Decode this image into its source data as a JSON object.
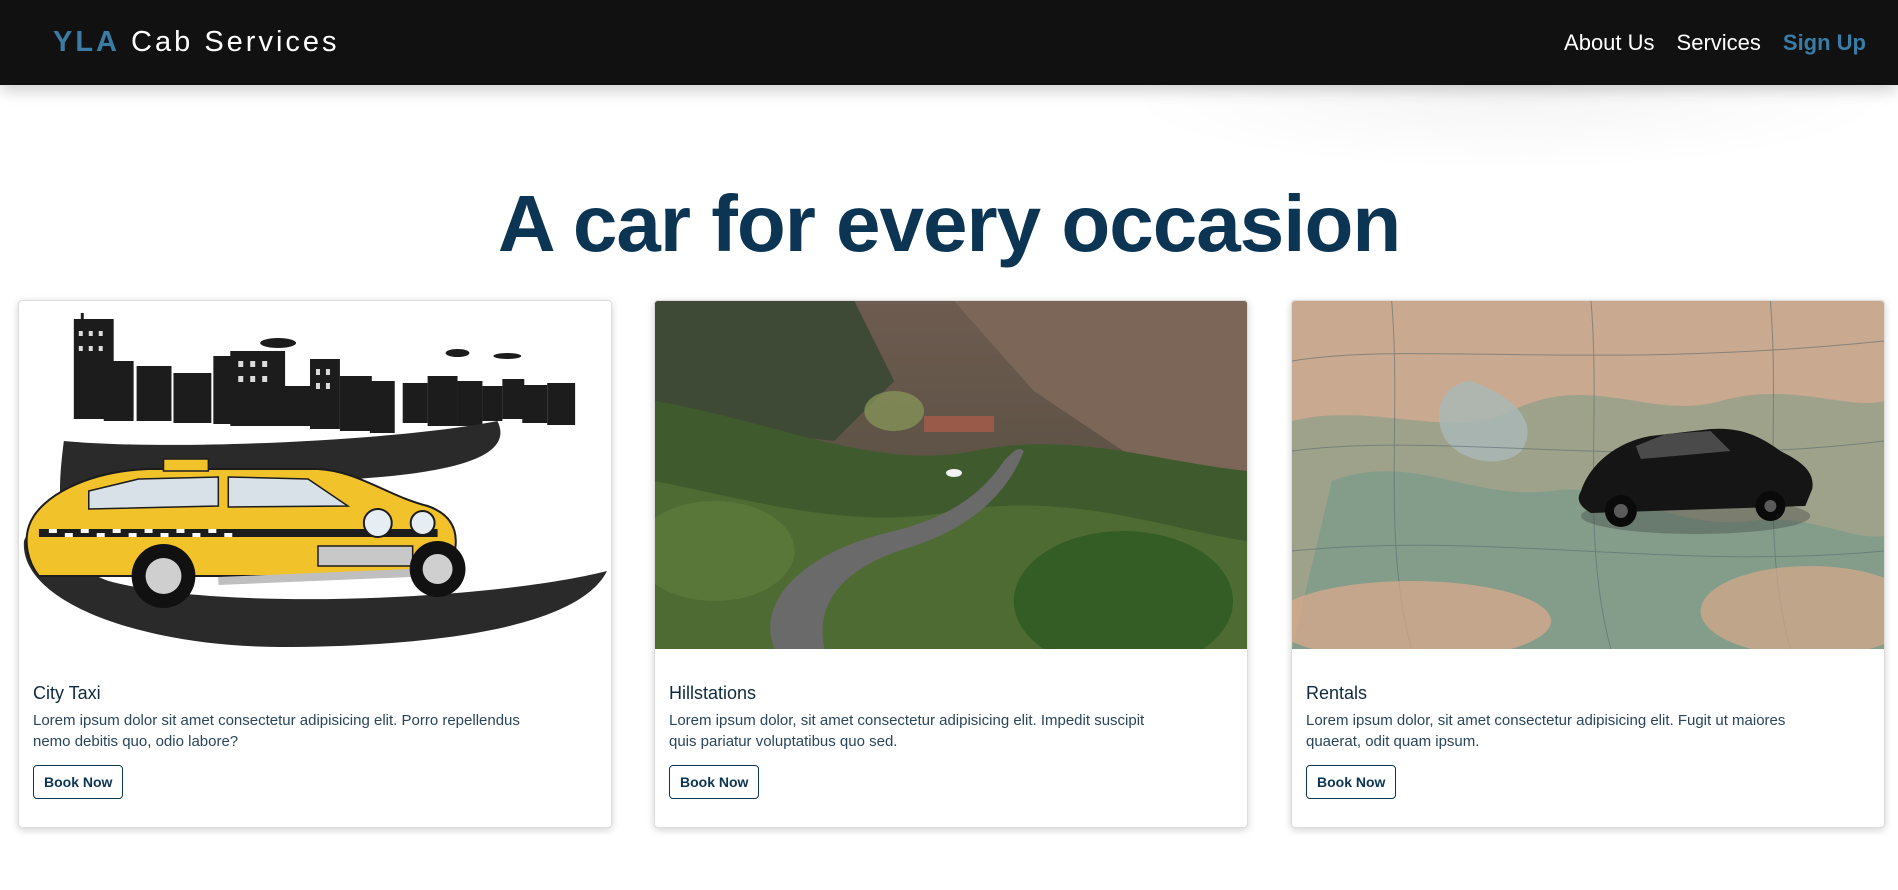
{
  "nav": {
    "brand_accent": "YLA",
    "brand_rest": " Cab Services",
    "links": [
      "About Us",
      "Services",
      "Sign Up"
    ]
  },
  "hero": {
    "headline": "A car for every occasion"
  },
  "cards": [
    {
      "title": "City Taxi",
      "text": "Lorem ipsum dolor sit amet consectetur adipisicing elit. Porro repellendus nemo debitis quo, odio labore?",
      "button": "Book Now"
    },
    {
      "title": "Hillstations",
      "text": "Lorem ipsum dolor, sit amet consectetur adipisicing elit. Impedit suscipit quis pariatur voluptatibus quo sed.",
      "button": "Book Now"
    },
    {
      "title": "Rentals",
      "text": "Lorem ipsum dolor, sit amet consectetur adipisicing elit. Fugit ut maiores quaerat, odit quam ipsum.",
      "button": "Book Now"
    }
  ],
  "colors": {
    "nav_bg": "#111111",
    "accent": "#3a7ca5",
    "headline": "#0c3553"
  }
}
